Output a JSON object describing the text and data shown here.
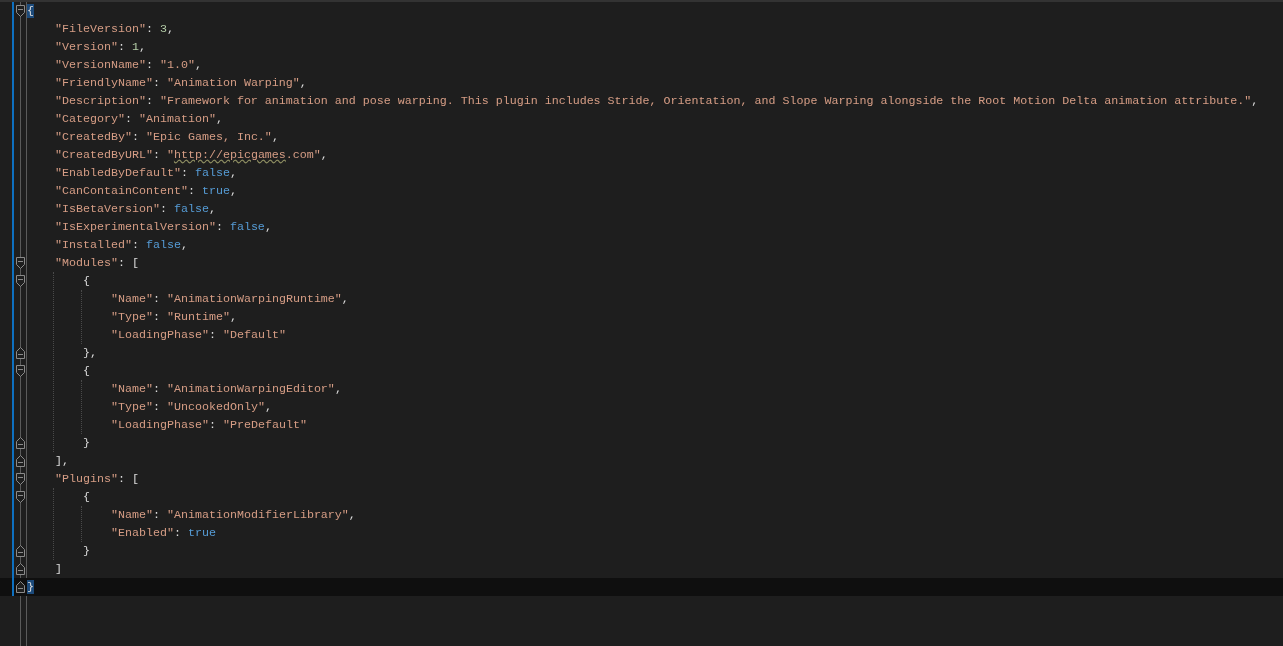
{
  "editor": {
    "document": {
      "tokens": [
        {
          "kind": "bracket-match",
          "text": "{"
        }
      ],
      "children": [
        {
          "tokens": [
            {
              "kind": "key",
              "text": "\"FileVersion\""
            },
            {
              "kind": "punct",
              "text": ": "
            },
            {
              "kind": "number",
              "text": "3"
            },
            {
              "kind": "punct",
              "text": ","
            }
          ]
        },
        {
          "tokens": [
            {
              "kind": "key",
              "text": "\"Version\""
            },
            {
              "kind": "punct",
              "text": ": "
            },
            {
              "kind": "number",
              "text": "1"
            },
            {
              "kind": "punct",
              "text": ","
            }
          ]
        },
        {
          "tokens": [
            {
              "kind": "key",
              "text": "\"VersionName\""
            },
            {
              "kind": "punct",
              "text": ": "
            },
            {
              "kind": "string",
              "text": "\"1.0\""
            },
            {
              "kind": "punct",
              "text": ","
            }
          ]
        },
        {
          "tokens": [
            {
              "kind": "key",
              "text": "\"FriendlyName\""
            },
            {
              "kind": "punct",
              "text": ": "
            },
            {
              "kind": "string",
              "text": "\"Animation Warping\""
            },
            {
              "kind": "punct",
              "text": ","
            }
          ]
        },
        {
          "tokens": [
            {
              "kind": "key",
              "text": "\"Description\""
            },
            {
              "kind": "punct",
              "text": ": "
            },
            {
              "kind": "string",
              "text": "\"Framework for animation and pose warping. This plugin includes Stride, Orientation, and Slope Warping alongside the Root Motion Delta animation attribute.\""
            },
            {
              "kind": "punct",
              "text": ","
            }
          ]
        },
        {
          "tokens": [
            {
              "kind": "key",
              "text": "\"Category\""
            },
            {
              "kind": "punct",
              "text": ": "
            },
            {
              "kind": "string",
              "text": "\"Animation\""
            },
            {
              "kind": "punct",
              "text": ","
            }
          ]
        },
        {
          "tokens": [
            {
              "kind": "key",
              "text": "\"CreatedBy\""
            },
            {
              "kind": "punct",
              "text": ": "
            },
            {
              "kind": "string",
              "text": "\"Epic Games, Inc.\""
            },
            {
              "kind": "punct",
              "text": ","
            }
          ]
        },
        {
          "tokens": [
            {
              "kind": "key",
              "text": "\"CreatedByURL\""
            },
            {
              "kind": "punct",
              "text": ": "
            },
            {
              "kind": "string",
              "text": "\""
            },
            {
              "kind": "spell-squiggle",
              "text": "http://epicgames"
            },
            {
              "kind": "string",
              "text": ".com\""
            },
            {
              "kind": "punct",
              "text": ","
            }
          ]
        },
        {
          "tokens": [
            {
              "kind": "key",
              "text": "\"EnabledByDefault\""
            },
            {
              "kind": "punct",
              "text": ": "
            },
            {
              "kind": "keyword",
              "text": "false"
            },
            {
              "kind": "punct",
              "text": ","
            }
          ]
        },
        {
          "tokens": [
            {
              "kind": "key",
              "text": "\"CanContainContent\""
            },
            {
              "kind": "punct",
              "text": ": "
            },
            {
              "kind": "keyword",
              "text": "true"
            },
            {
              "kind": "punct",
              "text": ","
            }
          ]
        },
        {
          "tokens": [
            {
              "kind": "key",
              "text": "\"IsBetaVersion\""
            },
            {
              "kind": "punct",
              "text": ": "
            },
            {
              "kind": "keyword",
              "text": "false"
            },
            {
              "kind": "punct",
              "text": ","
            }
          ]
        },
        {
          "tokens": [
            {
              "kind": "key",
              "text": "\"IsExperimentalVersion\""
            },
            {
              "kind": "punct",
              "text": ": "
            },
            {
              "kind": "keyword",
              "text": "false"
            },
            {
              "kind": "punct",
              "text": ","
            }
          ]
        },
        {
          "tokens": [
            {
              "kind": "key",
              "text": "\"Installed\""
            },
            {
              "kind": "punct",
              "text": ": "
            },
            {
              "kind": "keyword",
              "text": "false"
            },
            {
              "kind": "punct",
              "text": ","
            }
          ]
        },
        {
          "tokens": [
            {
              "kind": "key",
              "text": "\"Modules\""
            },
            {
              "kind": "punct",
              "text": ": ["
            }
          ],
          "children": [
            {
              "tokens": [
                {
                  "kind": "punct",
                  "text": "{"
                }
              ],
              "children": [
                {
                  "tokens": [
                    {
                      "kind": "key",
                      "text": "\"Name\""
                    },
                    {
                      "kind": "punct",
                      "text": ": "
                    },
                    {
                      "kind": "string",
                      "text": "\"AnimationWarpingRuntime\""
                    },
                    {
                      "kind": "punct",
                      "text": ","
                    }
                  ]
                },
                {
                  "tokens": [
                    {
                      "kind": "key",
                      "text": "\"Type\""
                    },
                    {
                      "kind": "punct",
                      "text": ": "
                    },
                    {
                      "kind": "string",
                      "text": "\"Runtime\""
                    },
                    {
                      "kind": "punct",
                      "text": ","
                    }
                  ]
                },
                {
                  "tokens": [
                    {
                      "kind": "key",
                      "text": "\"LoadingPhase\""
                    },
                    {
                      "kind": "punct",
                      "text": ": "
                    },
                    {
                      "kind": "string",
                      "text": "\"Default\""
                    }
                  ]
                }
              ],
              "close": {
                "tokens": [
                  {
                    "kind": "punct",
                    "text": "},"
                  }
                ],
                "current": false
              }
            },
            {
              "tokens": [
                {
                  "kind": "punct",
                  "text": "{"
                }
              ],
              "children": [
                {
                  "tokens": [
                    {
                      "kind": "key",
                      "text": "\"Name\""
                    },
                    {
                      "kind": "punct",
                      "text": ": "
                    },
                    {
                      "kind": "string",
                      "text": "\"AnimationWarpingEditor\""
                    },
                    {
                      "kind": "punct",
                      "text": ","
                    }
                  ]
                },
                {
                  "tokens": [
                    {
                      "kind": "key",
                      "text": "\"Type\""
                    },
                    {
                      "kind": "punct",
                      "text": ": "
                    },
                    {
                      "kind": "string",
                      "text": "\"UncookedOnly\""
                    },
                    {
                      "kind": "punct",
                      "text": ","
                    }
                  ]
                },
                {
                  "tokens": [
                    {
                      "kind": "key",
                      "text": "\"LoadingPhase\""
                    },
                    {
                      "kind": "punct",
                      "text": ": "
                    },
                    {
                      "kind": "string",
                      "text": "\"PreDefault\""
                    }
                  ]
                }
              ],
              "close": {
                "tokens": [
                  {
                    "kind": "punct",
                    "text": "}"
                  }
                ],
                "current": false
              }
            }
          ],
          "close": {
            "tokens": [
              {
                "kind": "punct",
                "text": "],"
              }
            ],
            "current": false
          }
        },
        {
          "tokens": [
            {
              "kind": "key",
              "text": "\"Plugins\""
            },
            {
              "kind": "punct",
              "text": ": ["
            }
          ],
          "children": [
            {
              "tokens": [
                {
                  "kind": "punct",
                  "text": "{"
                }
              ],
              "children": [
                {
                  "tokens": [
                    {
                      "kind": "key",
                      "text": "\"Name\""
                    },
                    {
                      "kind": "punct",
                      "text": ": "
                    },
                    {
                      "kind": "string",
                      "text": "\"AnimationModifierLibrary\""
                    },
                    {
                      "kind": "punct",
                      "text": ","
                    }
                  ]
                },
                {
                  "tokens": [
                    {
                      "kind": "key",
                      "text": "\"Enabled\""
                    },
                    {
                      "kind": "punct",
                      "text": ": "
                    },
                    {
                      "kind": "keyword",
                      "text": "true"
                    }
                  ]
                }
              ],
              "close": {
                "tokens": [
                  {
                    "kind": "punct",
                    "text": "}"
                  }
                ],
                "current": false
              }
            }
          ],
          "close": {
            "tokens": [
              {
                "kind": "punct",
                "text": "]"
              }
            ],
            "current": false
          }
        }
      ],
      "close": {
        "tokens": [
          {
            "kind": "bracket-match",
            "text": "}"
          }
        ],
        "current": true
      }
    }
  }
}
